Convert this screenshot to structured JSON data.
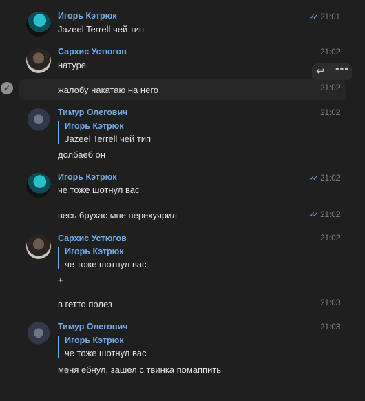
{
  "colors": {
    "background": "#1f1f1f",
    "accent": "#71aaeb",
    "text": "#e1e3e6",
    "time": "#828282"
  },
  "messages": [
    {
      "author": "Игорь Кэтрюк",
      "time": "21:01",
      "text": "Jazeel Terrell чей тип",
      "read": true
    },
    {
      "author": "Сархис Устюгов",
      "time": "21:02",
      "text": "натуре"
    },
    {
      "time": "21:02",
      "text": "жалобу накатаю на него",
      "hovered": true
    },
    {
      "author": "Тимур Олегович",
      "time": "21:02",
      "reply_author": "Игорь Кэтрюк",
      "reply_text": "Jazeel Terrell чей тип",
      "text": "долбаеб он"
    },
    {
      "author": "Игорь Кэтрюк",
      "time": "21:02",
      "text": "че тоже шотнул вас",
      "read": true
    },
    {
      "time": "21:02",
      "text": "весь брухас мне перехуярил",
      "read": true
    },
    {
      "author": "Сархис Устюгов",
      "time": "21:02",
      "reply_author": "Игорь Кэтрюк",
      "reply_text": "че тоже шотнул вас",
      "text": "+"
    },
    {
      "time": "21:03",
      "text": "в гетто полез"
    },
    {
      "author": "Тимур Олегович",
      "time": "21:03",
      "reply_author": "Игорь Кэтрюк",
      "reply_text": "че тоже шотнул вас",
      "text": "меня ебнул, зашел с твинка помаппить"
    }
  ],
  "icons": {
    "read": "double-check-icon",
    "reply": "reply-icon",
    "more": "more-icon",
    "select": "select-check-icon"
  }
}
